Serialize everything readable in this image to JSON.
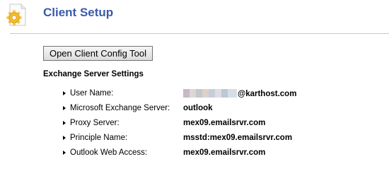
{
  "header": {
    "title": "Client Setup",
    "icon": "settings-gear-document-icon"
  },
  "toolbar": {
    "config_button_label": "Open Client Config Tool"
  },
  "exchange": {
    "heading": "Exchange Server Settings",
    "rows": [
      {
        "label": "User Name:",
        "value": "@karthost.com",
        "redacted_prefix": true
      },
      {
        "label": "Microsoft Exchange Server:",
        "value": "outlook"
      },
      {
        "label": "Proxy Server:",
        "value": "mex09.emailsrvr.com"
      },
      {
        "label": "Principle Name:",
        "value": "msstd:mex09.emailsrvr.com"
      },
      {
        "label": "Outlook Web Access:",
        "value": "mex09.emailsrvr.com"
      }
    ]
  },
  "colors": {
    "title": "#3a5aa8",
    "divider": "#c8c8c8"
  }
}
